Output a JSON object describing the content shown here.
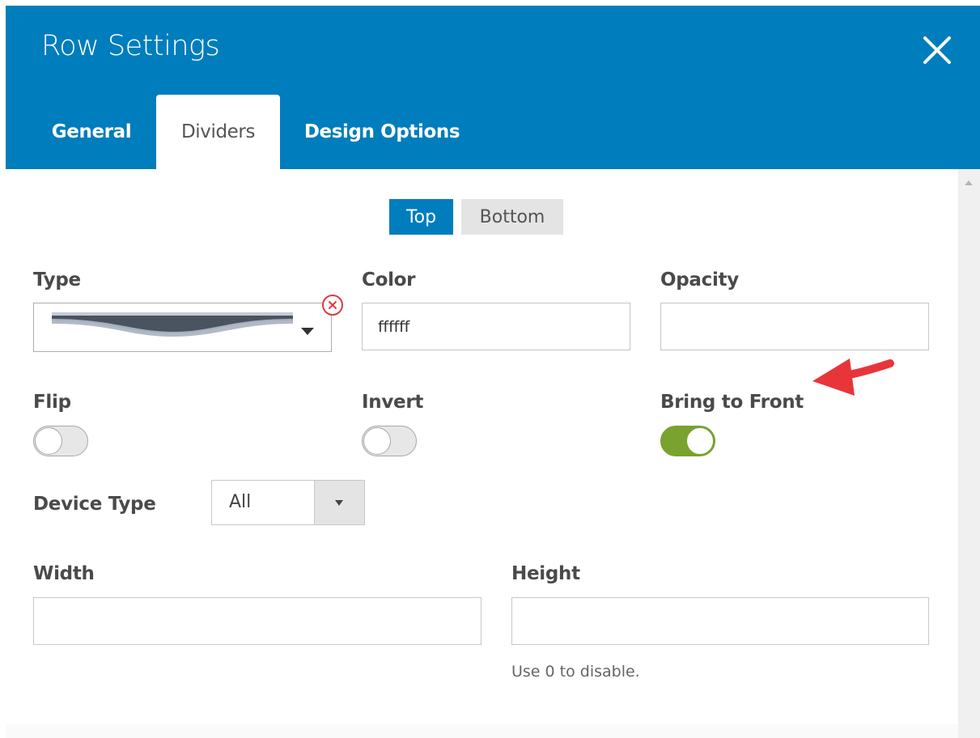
{
  "dialog": {
    "title": "Row Settings",
    "close_icon": "close-icon"
  },
  "tabs": [
    {
      "label": "General",
      "active": false
    },
    {
      "label": "Dividers",
      "active": true
    },
    {
      "label": "Design Options",
      "active": false
    }
  ],
  "position_toggle": {
    "options": [
      {
        "label": "Top",
        "selected": true
      },
      {
        "label": "Bottom",
        "selected": false
      }
    ]
  },
  "fields": {
    "type": {
      "label": "Type",
      "value_icon": "wave-divider-icon",
      "clear_icon": "clear-circle-x-icon"
    },
    "color": {
      "label": "Color",
      "value": "ffffff"
    },
    "opacity": {
      "label": "Opacity",
      "value": ""
    },
    "flip": {
      "label": "Flip",
      "on": false
    },
    "invert": {
      "label": "Invert",
      "on": false
    },
    "bring_to_front": {
      "label": "Bring to Front",
      "on": true
    },
    "device_type": {
      "label": "Device Type",
      "value": "All"
    },
    "width": {
      "label": "Width",
      "value": ""
    },
    "height": {
      "label": "Height",
      "value": "",
      "hint": "Use 0 to disable."
    }
  },
  "annotation": {
    "icon": "red-arrow-icon"
  },
  "colors": {
    "header": "#007dbd",
    "toggle_on": "#79a22e",
    "accent": "#007dbd",
    "annotation": "#e8353a"
  }
}
